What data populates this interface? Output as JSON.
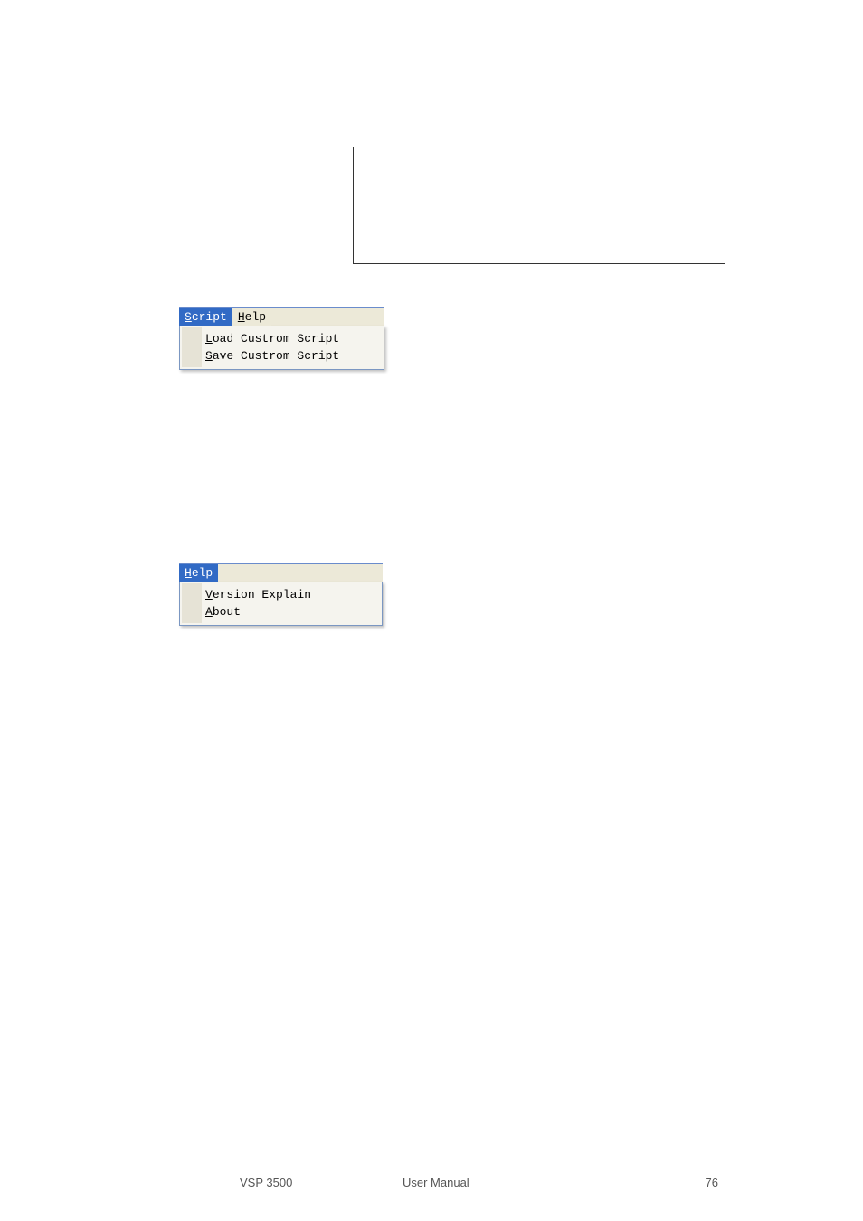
{
  "emptyBox": {},
  "scriptMenu": {
    "menubar": [
      {
        "label": "Script",
        "mnemonic": "S",
        "selected": true
      },
      {
        "label": "Help",
        "mnemonic": "H",
        "selected": false
      }
    ],
    "items": [
      {
        "label": "Load Custrom Script",
        "mnemonic": "L"
      },
      {
        "label": "Save Custrom Script",
        "mnemonic": "S"
      }
    ]
  },
  "helpMenu": {
    "menubar": [
      {
        "label": "Help",
        "mnemonic": "H",
        "selected": true
      }
    ],
    "items": [
      {
        "label": "Version Explain",
        "mnemonic": "V"
      },
      {
        "label": "About",
        "mnemonic": "A"
      }
    ]
  },
  "footer": {
    "left": "VSP 3500",
    "center": "User Manual",
    "right": "76"
  }
}
